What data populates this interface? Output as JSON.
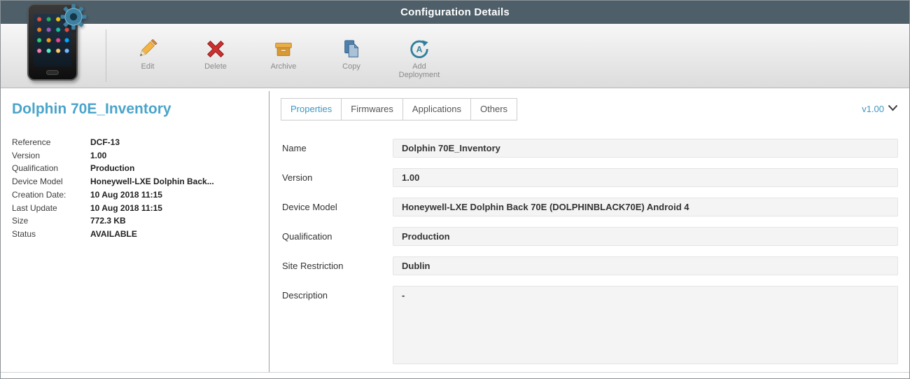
{
  "header": {
    "title": "Configuration Details"
  },
  "colors": {
    "accent": "#3f97c1",
    "header_bar": "#4e5f6a",
    "delete_red": "#cf3030",
    "archive_tan": "#e2a23c",
    "copy_blue": "#5b86ad",
    "deploy_teal": "#2e7f9e"
  },
  "toolbar": {
    "buttons": [
      {
        "label": "Edit",
        "icon": "pencil-icon"
      },
      {
        "label": "Delete",
        "icon": "delete-x-icon"
      },
      {
        "label": "Archive",
        "icon": "archive-box-icon"
      },
      {
        "label": "Copy",
        "icon": "copy-pages-icon"
      },
      {
        "label": "Add Deployment",
        "icon": "add-deployment-icon"
      }
    ]
  },
  "sidebar": {
    "title": "Dolphin 70E_Inventory",
    "fields": [
      {
        "label": "Reference",
        "value": "DCF-13"
      },
      {
        "label": "Version",
        "value": "1.00"
      },
      {
        "label": "Qualification",
        "value": "Production"
      },
      {
        "label": "Device Model",
        "value": "Honeywell-LXE Dolphin Back..."
      },
      {
        "label": "Creation Date:",
        "value": "10 Aug 2018 11:15"
      },
      {
        "label": "Last Update",
        "value": "10 Aug 2018 11:15"
      },
      {
        "label": "Size",
        "value": "772.3 KB"
      },
      {
        "label": "Status",
        "value": "AVAILABLE"
      }
    ]
  },
  "main": {
    "tabs": [
      {
        "label": "Properties",
        "active": true
      },
      {
        "label": "Firmwares",
        "active": false
      },
      {
        "label": "Applications",
        "active": false
      },
      {
        "label": "Others",
        "active": false
      }
    ],
    "version_selector": "v1.00",
    "form": [
      {
        "label": "Name",
        "value": "Dolphin 70E_Inventory"
      },
      {
        "label": "Version",
        "value": "1.00"
      },
      {
        "label": "Device Model",
        "value": "Honeywell-LXE Dolphin Back 70E (DOLPHINBLACK70E) Android 4"
      },
      {
        "label": "Qualification",
        "value": "Production"
      },
      {
        "label": "Site Restriction",
        "value": "Dublin"
      },
      {
        "label": "Description",
        "value": "-"
      }
    ]
  }
}
